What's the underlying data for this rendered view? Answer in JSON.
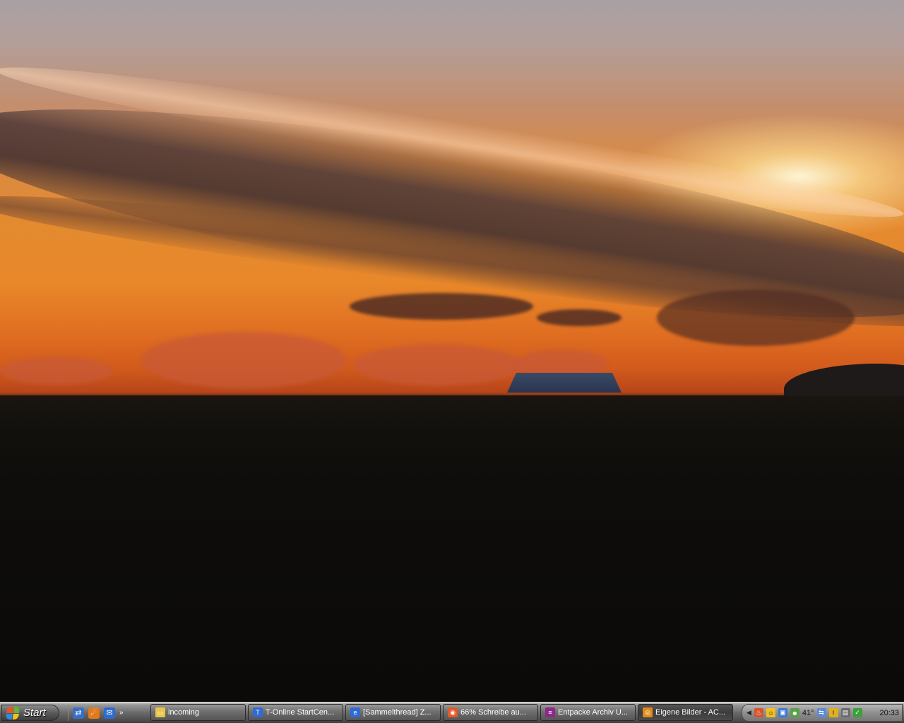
{
  "taskbar": {
    "start_label": "Start",
    "quick_launch": [
      {
        "icon": "network-icon"
      },
      {
        "icon": "firefox-icon"
      },
      {
        "icon": "outlook-icon"
      }
    ],
    "quick_launch_more": "»",
    "tasks": [
      {
        "label": "incoming",
        "icon": "folder-icon",
        "color": "#e8c44a",
        "active": false
      },
      {
        "label": "T-Online StartCen...",
        "icon": "t-online-icon",
        "color": "#2f6bd0",
        "active": false
      },
      {
        "label": "[Sammelthread] Z...",
        "icon": "browser-icon",
        "color": "#2f6bd0",
        "active": false
      },
      {
        "label": "66% Schreibe au...",
        "icon": "burn-icon",
        "color": "#e25a2a",
        "active": false
      },
      {
        "label": "Entpacke Archiv U...",
        "icon": "winrar-icon",
        "color": "#8b2a8b",
        "active": false
      },
      {
        "label": "Eigene Bilder - AC...",
        "icon": "acdsee-icon",
        "color": "#e08a1a",
        "active": true
      }
    ]
  },
  "tray": {
    "temperature": "41°",
    "clock": "20:33",
    "icons": [
      {
        "name": "fire-icon",
        "color": "#d9532a"
      },
      {
        "name": "smiley-icon",
        "color": "#f0c020"
      },
      {
        "name": "monitor-icon",
        "color": "#3a7ad8"
      },
      {
        "name": "people-icon",
        "color": "#5aa04a"
      },
      {
        "name": "network-tray-icon",
        "color": "#5a8ad8"
      },
      {
        "name": "warning-icon",
        "color": "#e0b020"
      },
      {
        "name": "printer-icon",
        "color": "#6a6a6a"
      },
      {
        "name": "security-icon",
        "color": "#3aa03a"
      }
    ]
  }
}
